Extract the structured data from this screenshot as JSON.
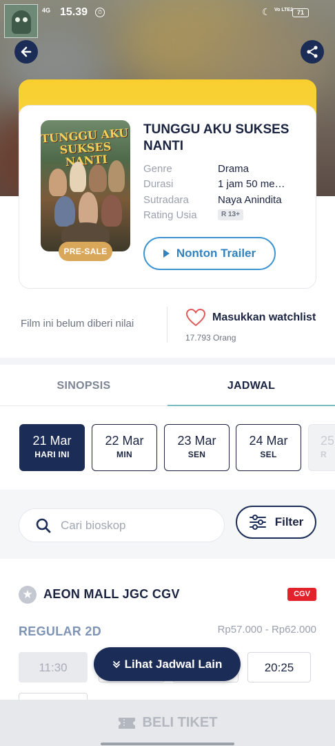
{
  "status_bar": {
    "network": "4G",
    "time": "15.39",
    "alarm_icon": "alarm-icon",
    "lte": "Vo LTE2",
    "battery": "71"
  },
  "movie": {
    "title": "TUNGGU AKU SUKSES NANTI",
    "poster_title": "TUNGGU AKU SUKSES NANTI",
    "presale_label": "PRE-SALE",
    "info": [
      {
        "label": "Genre",
        "value": "Drama"
      },
      {
        "label": "Durasi",
        "value": "1 jam 50 me…"
      },
      {
        "label": "Sutradara",
        "value": "Naya Anindita"
      },
      {
        "label": "Rating Usia",
        "value": "R 13+"
      }
    ],
    "trailer_label": "Nonton Trailer"
  },
  "rating": {
    "no_rating_text": "Film ini belum diberi nilai",
    "watchlist_label": "Masukkan watchlist",
    "watchlist_count": "17.793 Orang"
  },
  "tabs": [
    {
      "label": "SINOPSIS",
      "active": false
    },
    {
      "label": "JADWAL",
      "active": true
    }
  ],
  "dates": [
    {
      "date": "21 Mar",
      "day": "HARI INI",
      "active": true
    },
    {
      "date": "22 Mar",
      "day": "MIN",
      "active": false
    },
    {
      "date": "23 Mar",
      "day": "SEN",
      "active": false
    },
    {
      "date": "24 Mar",
      "day": "SEL",
      "active": false
    },
    {
      "date": "25",
      "day": "R",
      "active": false
    }
  ],
  "search": {
    "placeholder": "Cari bioskop"
  },
  "filter_label": "Filter",
  "cinema": {
    "name": "AEON MALL JGC CGV",
    "badge": "CGV",
    "format": "REGULAR 2D",
    "price": "Rp57.000 - Rp62.000",
    "times": [
      {
        "time": "11:30",
        "available": false
      },
      {
        "time": "20:25",
        "available": true
      }
    ]
  },
  "lihat_label": "Lihat Jadwal Lain",
  "beli_label": "BELI TIKET",
  "colors": {
    "navy": "#1b2c56",
    "yellow": "#f9cf2f",
    "accent_blue": "#2f82bf",
    "cgv_red": "#e3232c",
    "presale_gold": "#d9a75a"
  }
}
